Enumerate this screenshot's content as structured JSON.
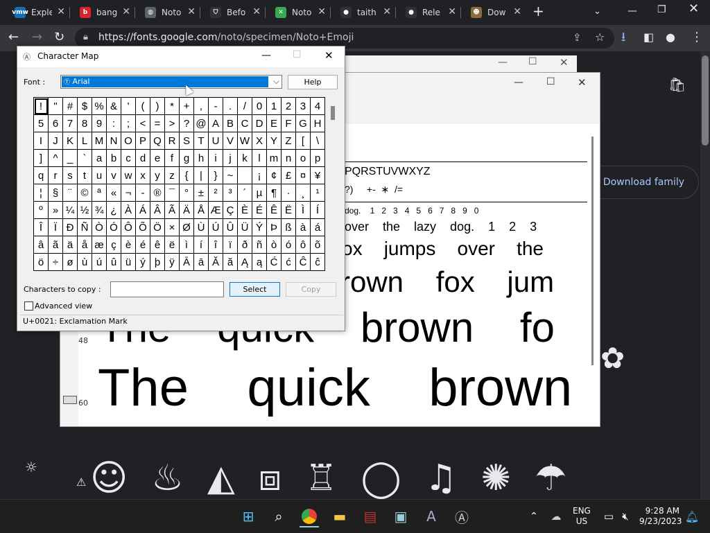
{
  "browser": {
    "tabs": [
      {
        "label": "Exple",
        "fav": "vmw",
        "color": "#146eb4"
      },
      {
        "label": "bang",
        "fav": "b",
        "color": "#d9232d"
      },
      {
        "label": "Noto",
        "fav": "globe-icon",
        "color": "#5f6368"
      },
      {
        "label": "Befo",
        "fav": "shield-icon",
        "color": "#303134"
      },
      {
        "label": "Noto",
        "fav": "google-fonts-icon",
        "color": "#34a853"
      },
      {
        "label": "taith",
        "fav": "github-icon",
        "color": "#303134"
      },
      {
        "label": "Rele",
        "fav": "github-icon",
        "color": "#303134"
      },
      {
        "label": "Dow",
        "fav": "squirrel-icon",
        "color": "#8a6d3b"
      }
    ],
    "url_host": "https://fonts.google.com",
    "url_path": "/noto/specimen/Noto+Emoji",
    "download_family": "Download family"
  },
  "preview": {
    "upper": "PQRSTUVWXYZ",
    "symbols": "?)     +-  ∗  /=",
    "row_dog": "dog.    1   2   3   4   5   6   7   8   9   0",
    "row1": "over    the    lazy    dog.    1    2    3",
    "row2": "ox    jumps    over    the",
    "row3": "rown    fox    jum",
    "row4": "The    quick    brown    fo",
    "row5": "The    quick    brown",
    "label48": "48",
    "label60": "60"
  },
  "charmap": {
    "title": "Character Map",
    "font_label": "Font :",
    "font_value": "Arial",
    "help": "Help",
    "chars_label": "Characters to copy :",
    "select": "Select",
    "copy": "Copy",
    "advanced": "Advanced view",
    "status": "U+0021: Exclamation Mark",
    "rows": [
      [
        "!",
        "\"",
        "#",
        "$",
        "%",
        "&",
        "'",
        "(",
        ")",
        "*",
        "+",
        ",",
        "-",
        ".",
        "/",
        "0",
        "1",
        "2",
        "3",
        "4"
      ],
      [
        "5",
        "6",
        "7",
        "8",
        "9",
        ":",
        ";",
        "<",
        "=",
        ">",
        "?",
        "@",
        "A",
        "B",
        "C",
        "D",
        "E",
        "F",
        "G",
        "H"
      ],
      [
        "I",
        "J",
        "K",
        "L",
        "M",
        "N",
        "O",
        "P",
        "Q",
        "R",
        "S",
        "T",
        "U",
        "V",
        "W",
        "X",
        "Y",
        "Z",
        "[",
        "\\"
      ],
      [
        "]",
        "^",
        "_",
        "`",
        "a",
        "b",
        "c",
        "d",
        "e",
        "f",
        "g",
        "h",
        "i",
        "j",
        "k",
        "l",
        "m",
        "n",
        "o",
        "p"
      ],
      [
        "q",
        "r",
        "s",
        "t",
        "u",
        "v",
        "w",
        "x",
        "y",
        "z",
        "{",
        "|",
        "}",
        "~",
        " ",
        "¡",
        "¢",
        "£",
        "¤",
        "¥"
      ],
      [
        "¦",
        "§",
        "¨",
        "©",
        "ª",
        "«",
        "¬",
        "-",
        "®",
        "¯",
        "°",
        "±",
        "²",
        "³",
        "´",
        "µ",
        "¶",
        "·",
        "¸",
        "¹"
      ],
      [
        "º",
        "»",
        "¼",
        "½",
        "¾",
        "¿",
        "À",
        "Á",
        "Â",
        "Ã",
        "Ä",
        "Å",
        "Æ",
        "Ç",
        "È",
        "É",
        "Ê",
        "Ë",
        "Ì",
        "Í"
      ],
      [
        "Î",
        "Ï",
        "Ð",
        "Ñ",
        "Ò",
        "Ó",
        "Ô",
        "Õ",
        "Ö",
        "×",
        "Ø",
        "Ù",
        "Ú",
        "Û",
        "Ü",
        "Ý",
        "Þ",
        "ß",
        "à",
        "á"
      ],
      [
        "â",
        "ã",
        "ä",
        "å",
        "æ",
        "ç",
        "è",
        "é",
        "ê",
        "ë",
        "ì",
        "í",
        "î",
        "ï",
        "ð",
        "ñ",
        "ò",
        "ó",
        "ô",
        "õ"
      ],
      [
        "ö",
        "÷",
        "ø",
        "ù",
        "ú",
        "û",
        "ü",
        "ý",
        "þ",
        "ÿ",
        "Ā",
        "ā",
        "Ă",
        "ă",
        "Ą",
        "ą",
        "Ć",
        "ć",
        "Ĉ",
        "ĉ"
      ]
    ]
  },
  "taskbar": {
    "lang1": "ENG",
    "lang2": "US",
    "time": "9:28 AM",
    "date": "9/23/2023"
  }
}
